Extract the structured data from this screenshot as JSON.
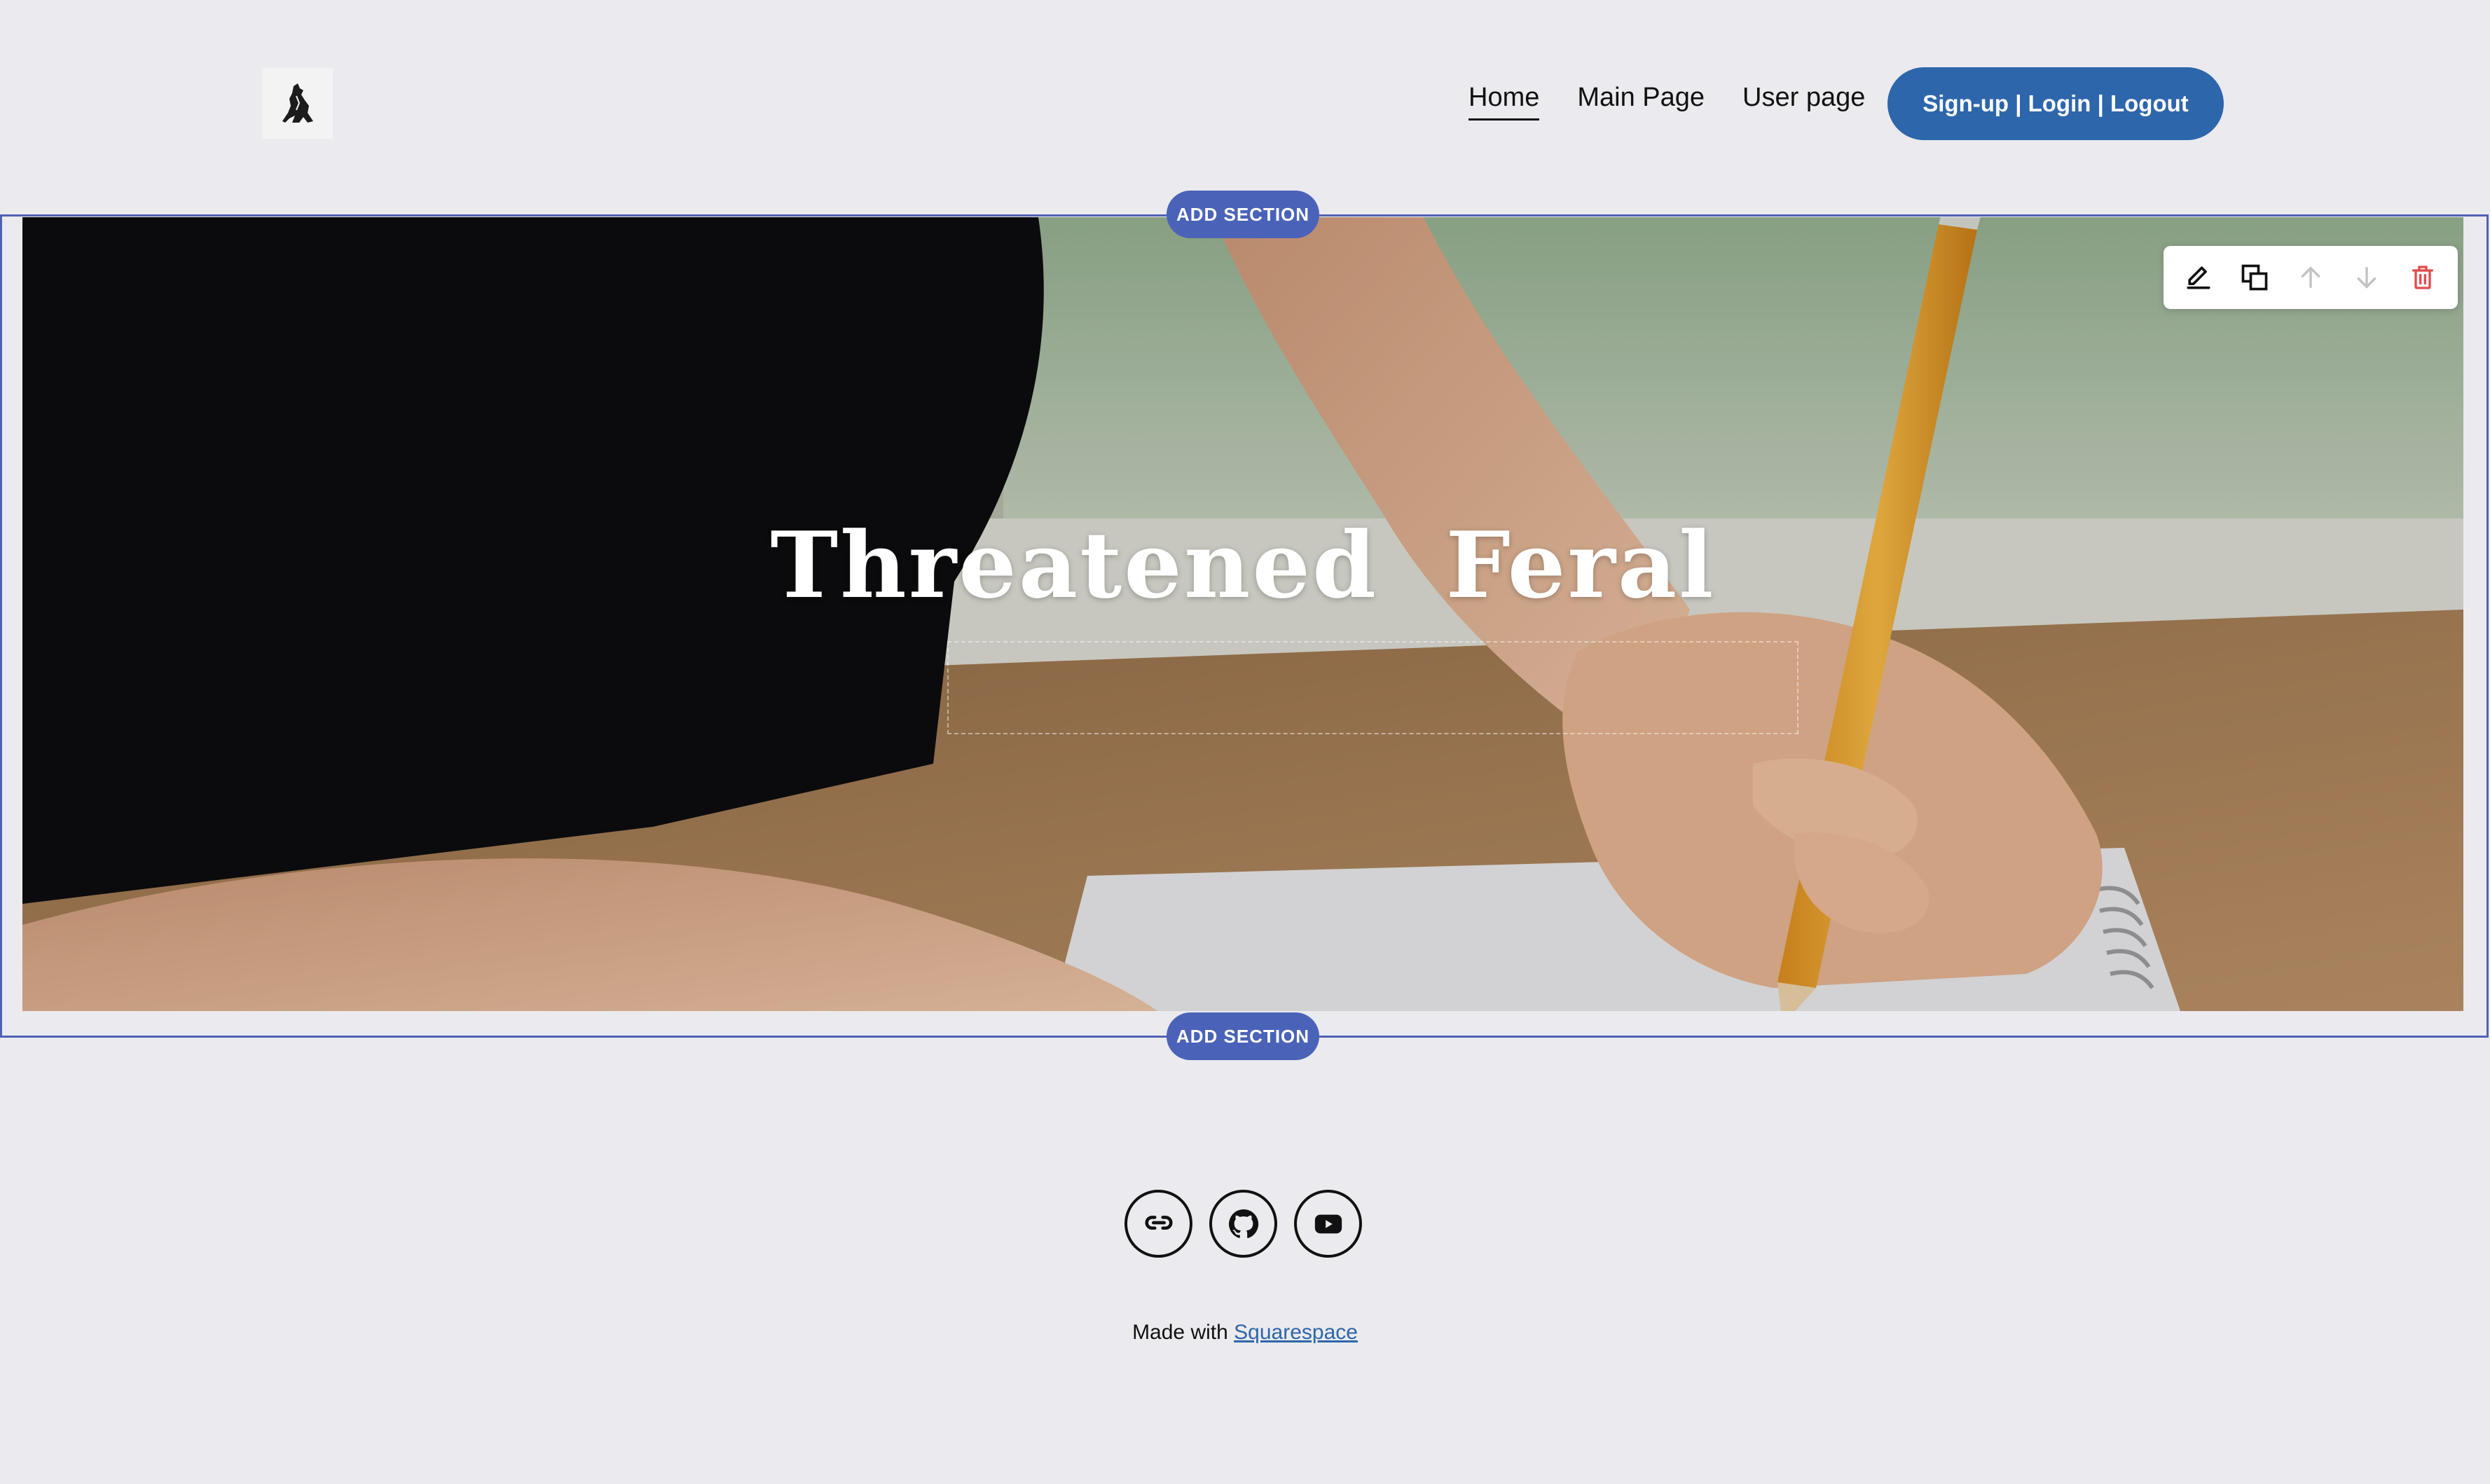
{
  "nav": {
    "items": [
      {
        "label": "Home",
        "active": true
      },
      {
        "label": "Main Page",
        "active": false
      },
      {
        "label": "User page",
        "active": false
      }
    ],
    "auth_button": "Sign-up | Login | Logout"
  },
  "editor": {
    "add_section_label": "ADD SECTION",
    "toolbar_icons": [
      "pencil-icon",
      "duplicate-icon",
      "arrow-up-icon",
      "arrow-down-icon",
      "trash-icon"
    ]
  },
  "hero": {
    "title": "Threatened  Feral"
  },
  "footer": {
    "social_icons": [
      "link-icon",
      "github-icon",
      "youtube-icon"
    ],
    "made_with_prefix": "Made with ",
    "made_with_link": "Squarespace"
  },
  "colors": {
    "background": "#ebeaee",
    "accent": "#2d66ab",
    "editor_blue": "#4a63b9",
    "delete_red": "#e24b4b"
  }
}
